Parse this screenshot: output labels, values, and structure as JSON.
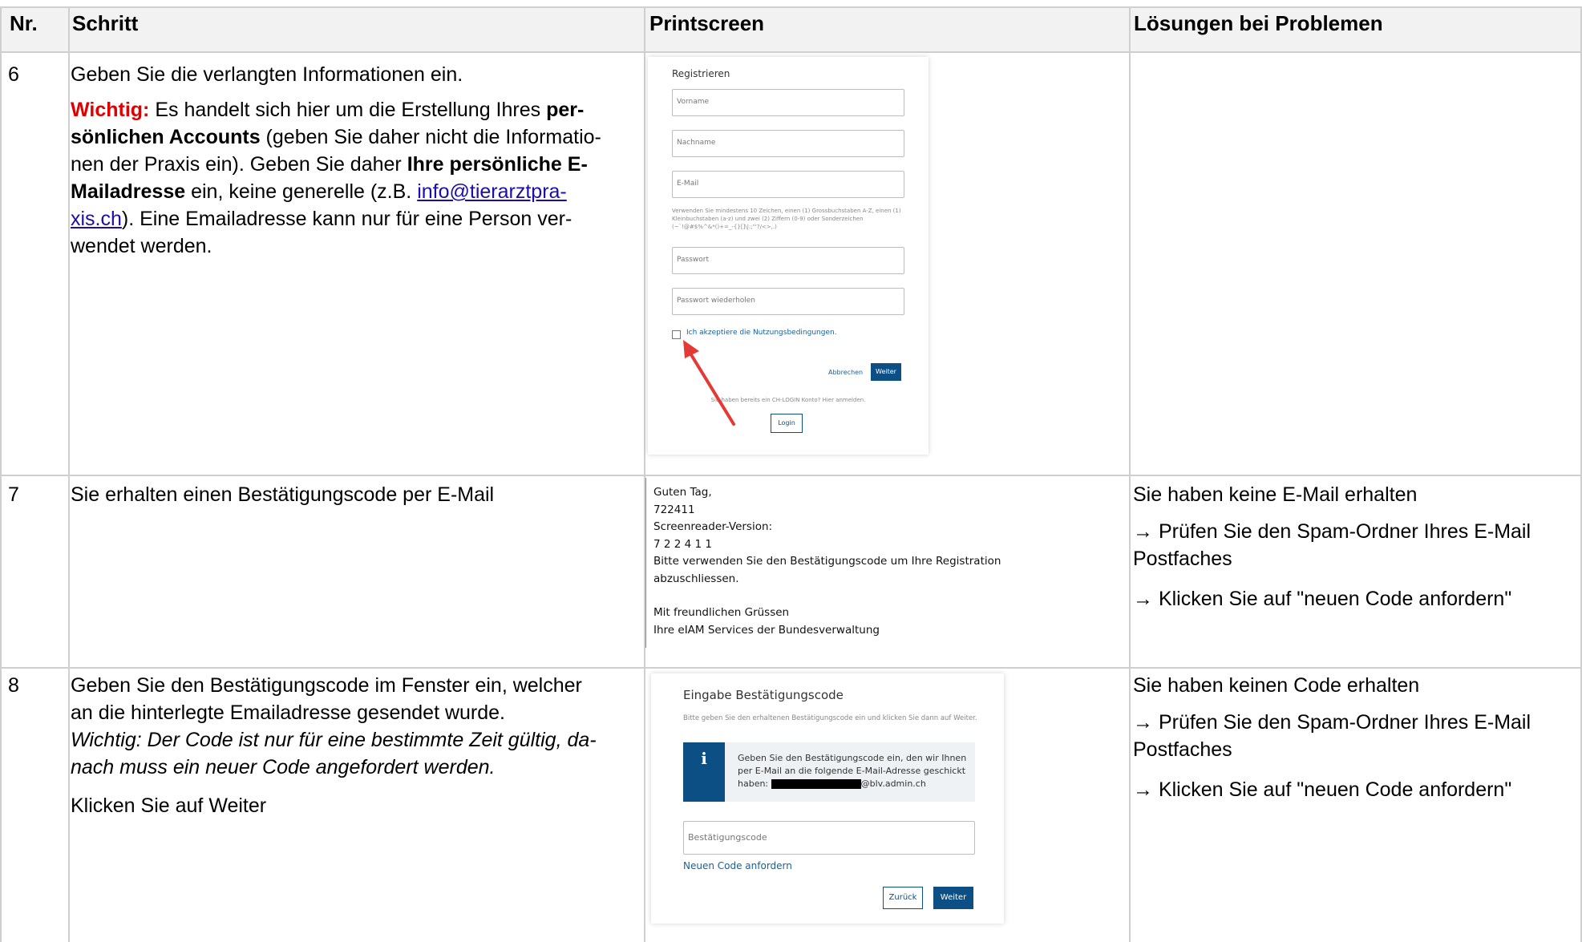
{
  "headers": {
    "nr": "Nr.",
    "schritt": "Schritt",
    "printscreen": "Printscreen",
    "loesungen": "Lösungen bei Problemen"
  },
  "rows": [
    {
      "nr": "6",
      "schritt_line1": "Geben Sie die verlangten Informationen ein.",
      "wichtig_label": "Wichtig:",
      "p_a": " Es handelt sich hier um die Erstellung Ihres ",
      "p_b_bold": "per-",
      "p_c_bold": "sönlichen Accounts",
      "p_d": " (geben Sie daher nicht die Informatio-",
      "p_e": "nen der Praxis ein). Geben Sie daher ",
      "p_f_bold": "Ihre persönliche E-",
      "p_g_bold": "Mailadresse",
      "p_h": " ein, keine generelle (z.B. ",
      "link1": "info@tierarztpra-",
      "link2": "xis.ch",
      "p_i": "). Eine Emailadresse kann nur für eine Person ver-",
      "p_j": "wendet werden."
    },
    {
      "nr": "7",
      "schritt": "Sie erhalten einen Bestätigungscode per E-Mail",
      "loesung_title": "Sie haben keine E-Mail erhalten",
      "loesung_1a": "→ Prüfen Sie den Spam-Ordner Ihres E-Mail",
      "loesung_1b": "Postfaches",
      "loesung_2": "→ Klicken Sie auf \"neuen Code anfordern\""
    },
    {
      "nr": "8",
      "schritt_1": "Geben Sie den Bestätigungscode im Fenster ein, welcher",
      "schritt_2": "an die hinterlegte Emailadresse gesendet wurde.",
      "schritt_3": "Wichtig: Der Code ist nur für eine bestimmte Zeit gültig, da-",
      "schritt_4": "nach muss ein neuer Code angefordert werden.",
      "schritt_5": "Klicken Sie auf Weiter",
      "loesung_title": "Sie haben keinen Code erhalten",
      "loesung_1a": "→ Prüfen Sie den Spam-Ordner Ihres E-Mail",
      "loesung_1b": "Postfaches",
      "loesung_2": "→ Klicken Sie auf \"neuen Code anfordern\""
    }
  ],
  "shot_register": {
    "title": "Registrieren",
    "vorname": "Vorname",
    "nachname": "Nachname",
    "email": "E-Mail",
    "hint": "Verwenden Sie mindestens 10 Zeichen, einen (1) Grossbuchstaben A-Z, einen (1) Kleinbuchstaben (a-z) und zwei (2) Ziffern (0-9) oder Sonderzeichen (~`!@#$%^&*()+=_-{}[]\\|:;\"'?/<>,.)",
    "passwort": "Passwort",
    "passwort_wdh": "Passwort wiederholen",
    "accept": "Ich akzeptiere die Nutzungsbedingungen.",
    "abbrechen": "Abbrechen",
    "weiter": "Weiter",
    "bereits": "Sie haben bereits ein CH-LOGIN Konto? Hier anmelden.",
    "login": "Login"
  },
  "mail": {
    "l1": "Guten Tag,",
    "l2": "722411",
    "l3": "Screenreader-Version:",
    "l4": "7 2 2 4 1 1",
    "l5": "Bitte verwenden Sie den Bestätigungscode um Ihre Registration",
    "l6": "abzuschliessen.",
    "l7": "Mit freundlichen Grüssen",
    "l8": "Ihre eIAM Services der Bundesverwaltung"
  },
  "shot_code": {
    "title": "Eingabe Bestätigungscode",
    "sub": "Bitte geben Sie den erhaltenen Bestätigungscode ein und klicken Sie dann auf Weiter.",
    "info_icon": "i",
    "info_1": "Geben Sie den Bestätigungscode ein, den wir Ihnen",
    "info_2": "per E-Mail an die folgende E-Mail-Adresse geschickt",
    "info_3": "haben:",
    "info_domain": "@blv.admin.ch",
    "field": "Bestätigungscode",
    "neu": "Neuen Code anfordern",
    "zurueck": "Zurück",
    "weiter": "Weiter"
  }
}
